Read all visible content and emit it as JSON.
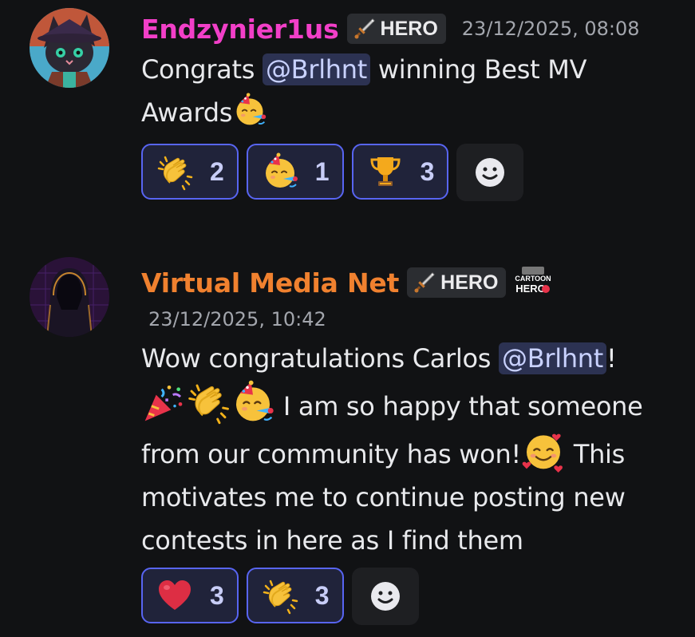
{
  "messages": [
    {
      "author": "Endzynier1us",
      "role_tag": "HERO",
      "timestamp": "23/12/2025, 08:08",
      "text_before_mention": "Congrats ",
      "mention": "@Brlhnt",
      "text_after_mention": " winning Best MV Awards",
      "trailing_emoji": "partying-face-emoji",
      "reactions": [
        {
          "emoji": "clapping-hands",
          "count": "2"
        },
        {
          "emoji": "partying-face",
          "count": "1"
        },
        {
          "emoji": "trophy",
          "count": "3"
        }
      ],
      "add_reaction_icon": "smiley-add-icon"
    },
    {
      "author": "Virtual Media Net",
      "role_tag": "HERO",
      "badge": "CARTOON HERO",
      "timestamp": "23/12/2025, 10:42",
      "text_before_mention": "Wow congratulations Carlos ",
      "mention": "@Brlhnt",
      "text_after_mention": "!",
      "inline_emojis": [
        "party-popper",
        "clapping-hands",
        "partying-face"
      ],
      "text_part2": " I am so happy that someone from our community has won!",
      "inline_emoji2": "smiling-face-with-hearts",
      "text_part3": " This motivates me to continue posting new contests in here as I find them",
      "reactions": [
        {
          "emoji": "red-heart",
          "count": "3"
        },
        {
          "emoji": "clapping-hands",
          "count": "3"
        }
      ],
      "add_reaction_icon": "smiley-add-icon"
    }
  ],
  "colors": {
    "background": "#111214",
    "author1": "#f23fc8",
    "author2": "#f0812f",
    "mention_bg": "#2c3252",
    "reaction_border": "#5865f2"
  }
}
